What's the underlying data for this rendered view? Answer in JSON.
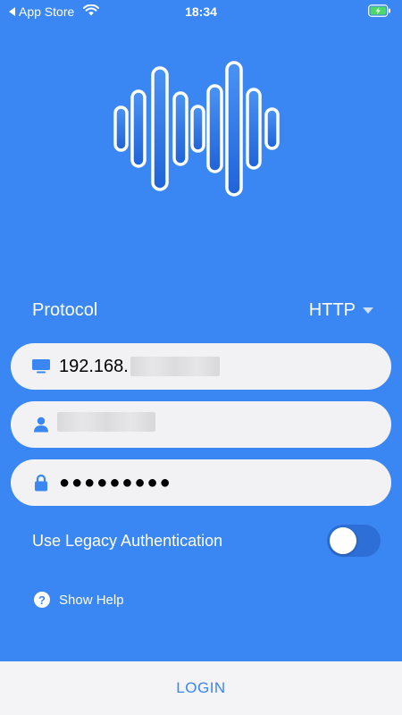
{
  "status_bar": {
    "back_label": "App Store",
    "time": "18:34"
  },
  "form": {
    "protocol_label": "Protocol",
    "protocol_value": "HTTP",
    "host_value": "192.168.",
    "password_value": "●●●●●●●●●",
    "legacy_auth_label": "Use Legacy Authentication",
    "legacy_auth_enabled": false,
    "help_label": "Show Help"
  },
  "login_label": "LOGIN",
  "colors": {
    "background": "#3a86f2",
    "field_background": "#f2f2f4",
    "login_text": "#3a86f2",
    "toggle_track": "#2d6fd6"
  },
  "icons": {
    "logo": "sound-wave-icon",
    "host": "monitor-icon",
    "user": "user-icon",
    "password": "lock-icon",
    "help": "question-icon"
  }
}
